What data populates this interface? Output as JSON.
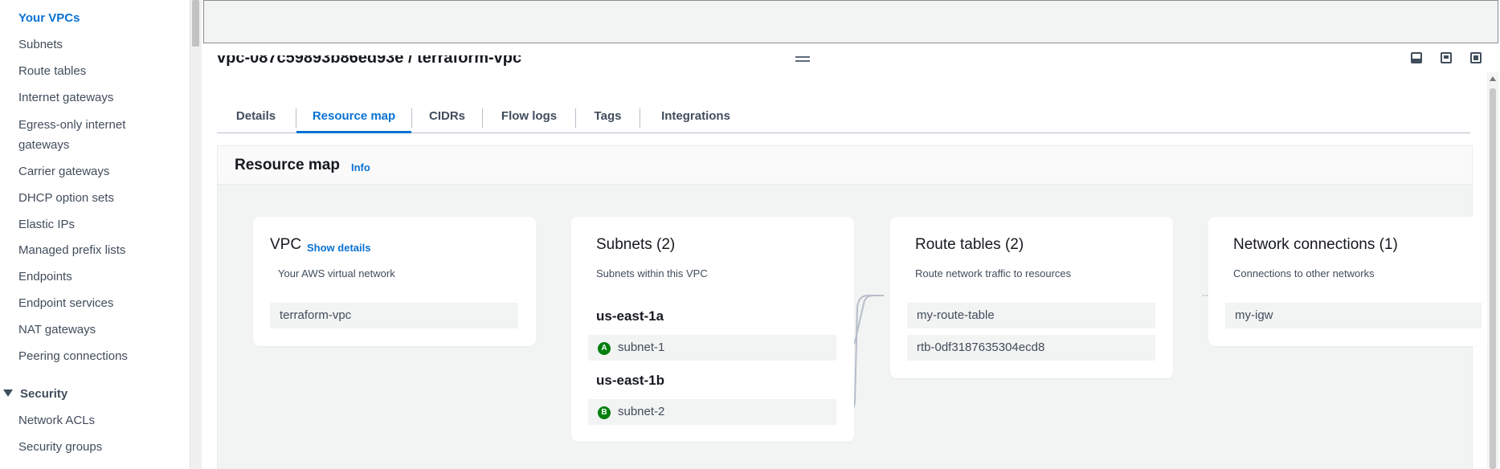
{
  "sidebar": {
    "items": [
      {
        "label": "Your VPCs",
        "active": true
      },
      {
        "label": "Subnets"
      },
      {
        "label": "Route tables"
      },
      {
        "label": "Internet gateways"
      },
      {
        "label": "Egress-only internet"
      },
      {
        "label": "gateways"
      },
      {
        "label": "Carrier gateways"
      },
      {
        "label": "DHCP option sets"
      },
      {
        "label": "Elastic IPs"
      },
      {
        "label": "Managed prefix lists"
      },
      {
        "label": "Endpoints"
      },
      {
        "label": "Endpoint services"
      },
      {
        "label": "NAT gateways"
      },
      {
        "label": "Peering connections"
      }
    ],
    "section": "Security",
    "security_items": [
      {
        "label": "Network ACLs"
      },
      {
        "label": "Security groups"
      }
    ]
  },
  "panel": {
    "title": "vpc-087c59893b86ed93e / terraform-vpc",
    "position_icons": [
      "panel-bottom-icon",
      "panel-side-icon",
      "panel-full-icon"
    ],
    "tabs": [
      {
        "label": "Details"
      },
      {
        "label": "Resource map",
        "active": true
      },
      {
        "label": "CIDRs"
      },
      {
        "label": "Flow logs"
      },
      {
        "label": "Tags"
      },
      {
        "label": "Integrations"
      }
    ]
  },
  "resource_map": {
    "title": "Resource map",
    "info_link": "Info",
    "vpc": {
      "title": "VPC",
      "show_details": "Show details",
      "subtitle": "Your AWS virtual network",
      "name": "terraform-vpc"
    },
    "subnets": {
      "title": "Subnets (2)",
      "subtitle": "Subnets within this VPC",
      "zones": [
        {
          "az": "us-east-1a",
          "badge": "A",
          "subnet": "subnet-1"
        },
        {
          "az": "us-east-1b",
          "badge": "B",
          "subnet": "subnet-2"
        }
      ]
    },
    "route_tables": {
      "title": "Route tables (2)",
      "subtitle": "Route network traffic to resources",
      "items": [
        "my-route-table",
        "rtb-0df3187635304ecd8"
      ]
    },
    "network_connections": {
      "title": "Network connections (1)",
      "subtitle": "Connections to other networks",
      "items": [
        "my-igw"
      ]
    }
  },
  "colors": {
    "accent": "#0972d3",
    "badge": "#037f0c",
    "map_background": "#f2f3f3"
  }
}
